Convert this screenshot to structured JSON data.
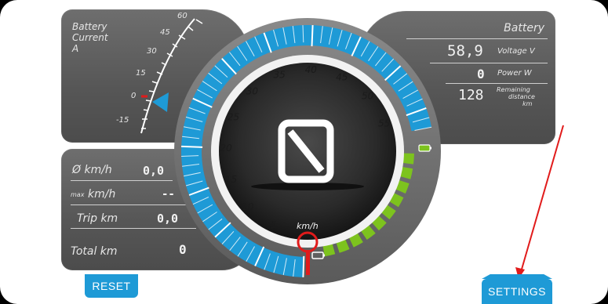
{
  "current_panel": {
    "label_line1": "Battery",
    "label_line2": "Current",
    "label_line3": "A",
    "scale_ticks": [
      "60",
      "45",
      "30",
      "15",
      "0",
      "-15"
    ]
  },
  "stats_panel": {
    "avg_speed_label": "Ø km/h",
    "avg_speed_value": "0,0",
    "max_prefix": "max",
    "max_speed_label": "km/h",
    "max_speed_value": "--",
    "trip_label": "Trip km",
    "trip_value": "0,0",
    "total_label": "Total km",
    "total_value": "0"
  },
  "battery_panel": {
    "title": "Battery",
    "voltage_value": "58,9",
    "voltage_label": "Voltage V",
    "power_value": "0",
    "power_label": "Power W",
    "remaining_value": "128",
    "remaining_label_line1": "Remaining",
    "remaining_label_line2": "distance",
    "remaining_label_line3": "km"
  },
  "speedometer": {
    "speed_value": "0",
    "unit": "km/h",
    "scale_labels": [
      "5",
      "10",
      "15",
      "20",
      "25",
      "30",
      "35",
      "40",
      "45",
      "50",
      "55"
    ],
    "scale_values": [
      5,
      10,
      15,
      20,
      25,
      30,
      35,
      40,
      45,
      50,
      55
    ],
    "current_speed": 0,
    "accent_color": "#1e9ad6",
    "battery_arc_color": "#7dc31e",
    "needle_color": "#e11b1b",
    "battery_level_segments": 10
  },
  "buttons": {
    "reset_label": "RESET",
    "settings_label": "SETTINGS"
  }
}
